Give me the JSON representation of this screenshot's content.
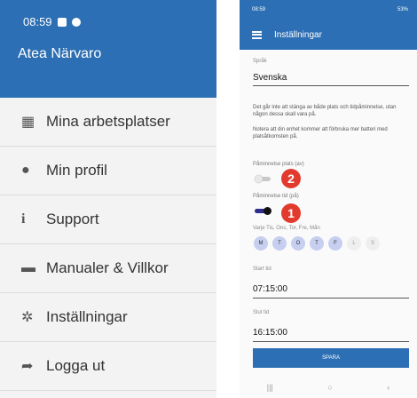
{
  "left": {
    "status": {
      "time": "08:59"
    },
    "org_name": "Atea Närvaro",
    "menu": [
      {
        "icon": "building-icon",
        "glyph": "▦",
        "label": "Mina arbetsplatser"
      },
      {
        "icon": "user-icon",
        "glyph": "●",
        "label": "Min profil"
      },
      {
        "icon": "info-icon",
        "glyph": "i",
        "label": "Support"
      },
      {
        "icon": "book-icon",
        "glyph": "▬",
        "label": "Manualer & Villkor"
      },
      {
        "icon": "gear-icon",
        "glyph": "✲",
        "label": "Inställningar"
      },
      {
        "icon": "sign-out-icon",
        "glyph": "➦",
        "label": "Logga ut"
      }
    ]
  },
  "right": {
    "status": {
      "time": "08:59",
      "battery": "53%"
    },
    "title": "Inställningar",
    "language": {
      "label": "Språk",
      "value": "Svenska"
    },
    "info1": "Det går inte att stänga av både plats och tidpåminnelse, utan någon dessa skall vara på.",
    "info2": "Notera att din enhet kommer att förbruka mer batteri med platsåtkomsten på.",
    "place_reminder": {
      "label": "Påminnelse plats (av)",
      "on": false,
      "badge": "2"
    },
    "time_reminder": {
      "label": "Påminnelse tid (på)",
      "on": true,
      "badge": "1"
    },
    "days_label": "Varje Tis, Ons, Tor, Fre, Mån",
    "days": [
      {
        "label": "M",
        "selected": true
      },
      {
        "label": "T",
        "selected": true
      },
      {
        "label": "O",
        "selected": true
      },
      {
        "label": "T",
        "selected": true
      },
      {
        "label": "F",
        "selected": true
      },
      {
        "label": "L",
        "selected": false
      },
      {
        "label": "S",
        "selected": false
      }
    ],
    "start": {
      "label": "Start tid",
      "value": "07:15:00"
    },
    "end": {
      "label": "Slut tid",
      "value": "16:15:00"
    },
    "save_label": "SPARA",
    "nav": {
      "recents": "|||",
      "home": "○",
      "back": "‹"
    }
  },
  "colors": {
    "brand": "#2d6fb4",
    "badge": "#e23b2e"
  }
}
